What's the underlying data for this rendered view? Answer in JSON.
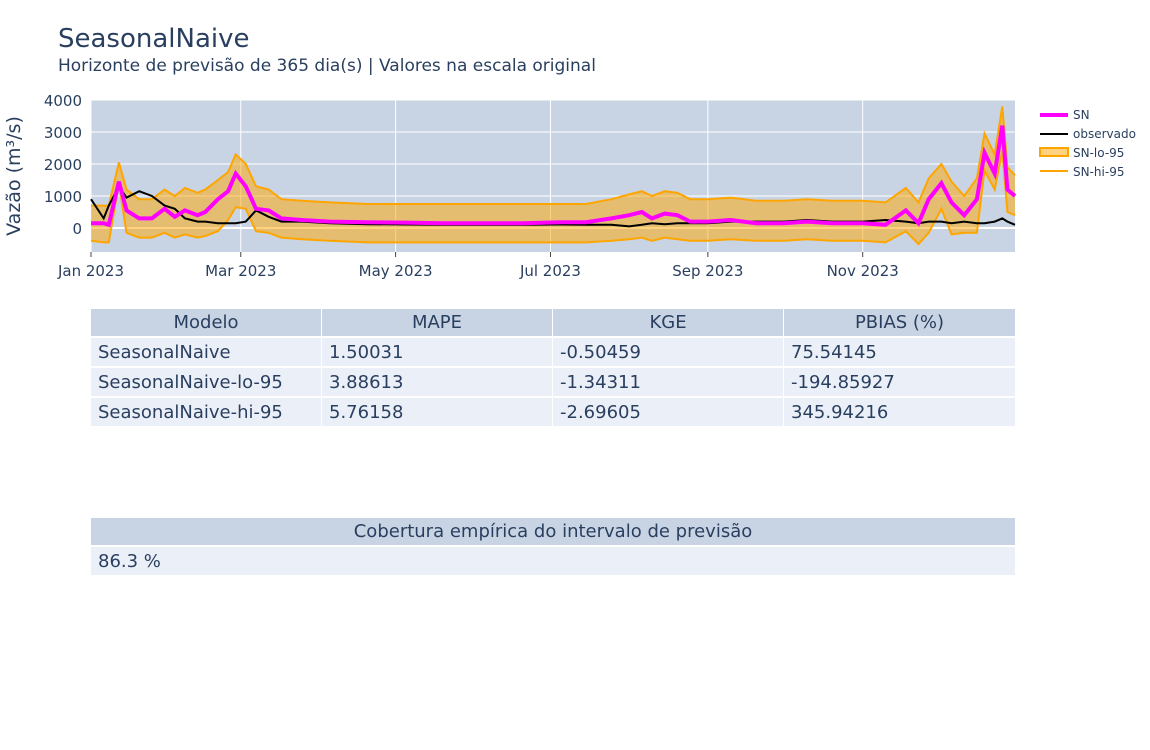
{
  "header": {
    "title": "SeasonalNaive",
    "subtitle": "Horizonte de previsão de 365 dia(s) | Valores na escala original"
  },
  "chart_data": {
    "type": "line",
    "title": "SeasonalNaive",
    "subtitle": "Horizonte de previsão de 365 dia(s) | Valores na escala original",
    "xlabel": "",
    "ylabel": "Vazão (m³/s)",
    "xlim": [
      "2023-01-01",
      "2023-12-31"
    ],
    "ylim": [
      -750,
      4000
    ],
    "yticks": [
      0,
      1000,
      2000,
      3000,
      4000
    ],
    "xticks": [
      "2023-01-01",
      "2023-03-01",
      "2023-05-01",
      "2023-07-01",
      "2023-09-01",
      "2023-11-01"
    ],
    "xtick_labels": [
      "Jan 2023",
      "Mar 2023",
      "May 2023",
      "Jul 2023",
      "Sep 2023",
      "Nov 2023"
    ],
    "grid": true,
    "legend_position": "right",
    "x": [
      "2023-01-01",
      "2023-01-06",
      "2023-01-08",
      "2023-01-12",
      "2023-01-15",
      "2023-01-20",
      "2023-01-25",
      "2023-01-30",
      "2023-02-03",
      "2023-02-07",
      "2023-02-12",
      "2023-02-15",
      "2023-02-20",
      "2023-02-24",
      "2023-02-27",
      "2023-03-03",
      "2023-03-07",
      "2023-03-12",
      "2023-03-17",
      "2023-03-25",
      "2023-04-05",
      "2023-04-20",
      "2023-05-05",
      "2023-05-20",
      "2023-06-05",
      "2023-06-20",
      "2023-07-05",
      "2023-07-15",
      "2023-07-25",
      "2023-08-01",
      "2023-08-06",
      "2023-08-10",
      "2023-08-15",
      "2023-08-20",
      "2023-08-25",
      "2023-09-01",
      "2023-09-10",
      "2023-09-20",
      "2023-10-01",
      "2023-10-10",
      "2023-10-20",
      "2023-11-01",
      "2023-11-10",
      "2023-11-18",
      "2023-11-23",
      "2023-11-27",
      "2023-12-02",
      "2023-12-06",
      "2023-12-11",
      "2023-12-16",
      "2023-12-19",
      "2023-12-23",
      "2023-12-26",
      "2023-12-28",
      "2023-12-31"
    ],
    "series": [
      {
        "name": "SN",
        "color": "#ff00ff",
        "values": [
          150,
          150,
          100,
          1450,
          550,
          300,
          300,
          600,
          350,
          550,
          400,
          500,
          900,
          1150,
          1700,
          1300,
          600,
          550,
          300,
          250,
          200,
          180,
          170,
          150,
          150,
          150,
          180,
          180,
          300,
          400,
          500,
          300,
          450,
          400,
          200,
          200,
          250,
          150,
          150,
          200,
          150,
          150,
          100,
          550,
          150,
          900,
          1400,
          800,
          400,
          900,
          2350,
          1700,
          3200,
          1200,
          1000
        ]
      },
      {
        "name": "observado",
        "color": "#000000",
        "values": [
          900,
          300,
          700,
          1300,
          950,
          1150,
          1000,
          700,
          600,
          300,
          200,
          200,
          150,
          150,
          150,
          200,
          550,
          350,
          200,
          200,
          150,
          120,
          110,
          100,
          100,
          100,
          110,
          100,
          100,
          50,
          100,
          150,
          120,
          150,
          150,
          150,
          200,
          200,
          200,
          250,
          200,
          200,
          250,
          200,
          150,
          200,
          200,
          150,
          200,
          150,
          150,
          200,
          300,
          200,
          100
        ]
      },
      {
        "name": "SN-lo-95",
        "color": "#ffa500",
        "values": [
          -400,
          -450,
          -450,
          1400,
          -150,
          -300,
          -300,
          -150,
          -300,
          -200,
          -300,
          -250,
          -100,
          250,
          650,
          600,
          -100,
          -150,
          -300,
          -350,
          -400,
          -450,
          -450,
          -450,
          -450,
          -450,
          -450,
          -450,
          -400,
          -350,
          -300,
          -400,
          -300,
          -350,
          -400,
          -400,
          -350,
          -400,
          -400,
          -350,
          -400,
          -400,
          -450,
          -100,
          -500,
          -150,
          600,
          -200,
          -150,
          -150,
          1800,
          1200,
          2400,
          500,
          400
        ]
      },
      {
        "name": "SN-hi-95",
        "color": "#ffa500",
        "values": [
          700,
          700,
          700,
          2050,
          1200,
          900,
          900,
          1200,
          1000,
          1250,
          1100,
          1200,
          1500,
          1750,
          2300,
          2000,
          1300,
          1200,
          900,
          850,
          800,
          750,
          750,
          750,
          750,
          750,
          750,
          750,
          900,
          1050,
          1150,
          1000,
          1150,
          1100,
          900,
          900,
          950,
          850,
          850,
          900,
          850,
          850,
          800,
          1250,
          800,
          1550,
          2000,
          1450,
          1000,
          1550,
          2950,
          2300,
          3800,
          1900,
          1650
        ]
      }
    ]
  },
  "legend": {
    "items": [
      "SN",
      "observado",
      "SN-lo-95",
      "SN-hi-95"
    ]
  },
  "metrics_table": {
    "headers": [
      "Modelo",
      "MAPE",
      "KGE",
      "PBIAS (%)"
    ],
    "rows": [
      [
        "SeasonalNaive",
        "1.50031",
        "-0.50459",
        "75.54145"
      ],
      [
        "SeasonalNaive-lo-95",
        "3.88613",
        "-1.34311",
        "-194.85927"
      ],
      [
        "SeasonalNaive-hi-95",
        "5.76158",
        "-2.69605",
        "345.94216"
      ]
    ]
  },
  "coverage_table": {
    "header": "Cobertura empírica do intervalo de previsão",
    "value": "86.3 %"
  }
}
